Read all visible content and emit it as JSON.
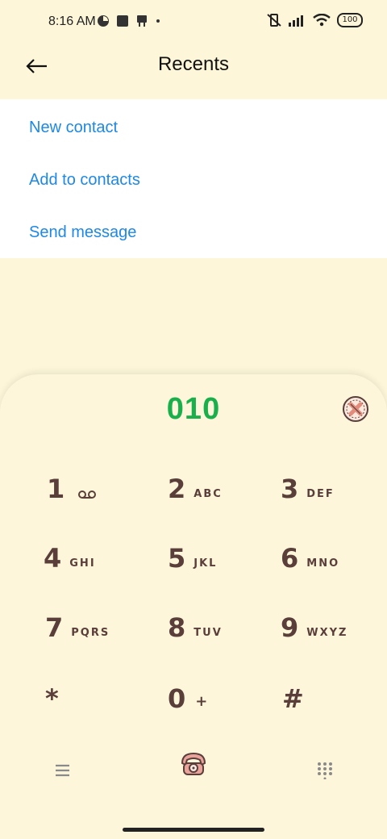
{
  "status": {
    "time": "8:16 AM",
    "battery": "100"
  },
  "header": {
    "title": "Recents"
  },
  "menu": {
    "items": [
      {
        "label": "New contact"
      },
      {
        "label": "Add to contacts"
      },
      {
        "label": "Send message"
      }
    ]
  },
  "dialer": {
    "number": "010",
    "keys": [
      {
        "digit": "1",
        "letters": ""
      },
      {
        "digit": "2",
        "letters": "ABC"
      },
      {
        "digit": "3",
        "letters": "DEF"
      },
      {
        "digit": "4",
        "letters": "GHI"
      },
      {
        "digit": "5",
        "letters": "JKL"
      },
      {
        "digit": "6",
        "letters": "MNO"
      },
      {
        "digit": "7",
        "letters": "PQRS"
      },
      {
        "digit": "8",
        "letters": "TUV"
      },
      {
        "digit": "9",
        "letters": "WXYZ"
      },
      {
        "digit": "*",
        "letters": ""
      },
      {
        "digit": "0",
        "letters": "+"
      },
      {
        "digit": "#",
        "letters": ""
      }
    ]
  },
  "icons": {
    "back": "back-arrow-icon",
    "backspace": "backspace-icon",
    "voicemail": "voicemail-icon",
    "menu": "menu-icon",
    "call": "call-icon",
    "dialpad": "dialpad-icon"
  },
  "colors": {
    "background": "#FDF6D9",
    "link": "#1E88E5",
    "number": "#19B04C",
    "keys": "#5A3E3A"
  }
}
